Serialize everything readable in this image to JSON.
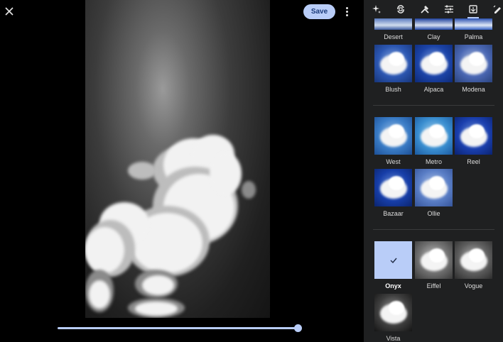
{
  "header": {
    "save_label": "Save"
  },
  "icons": {
    "close": "close-icon",
    "more": "more-vertical-icon"
  },
  "toolbar": {
    "tools": [
      "auto-enhance-icon",
      "crop-rotate-icon",
      "tools-icon",
      "adjust-icon",
      "filters-icon",
      "markup-icon"
    ],
    "active": "filters-icon"
  },
  "filters": {
    "row0": [
      "Desert",
      "Clay",
      "Palma"
    ],
    "row1": [
      "Blush",
      "Alpaca",
      "Modena"
    ],
    "row2": [
      "West",
      "Metro",
      "Reel"
    ],
    "row3": [
      "Bazaar",
      "Ollie"
    ],
    "row4": [
      "Onyx",
      "Eiffel",
      "Vogue"
    ],
    "row5": [
      "Vista"
    ],
    "selected": "Onyx"
  },
  "slider": {
    "value": 1.0
  },
  "colors": {
    "accent": "#b9cdf8",
    "panel_bg": "#1f2021"
  }
}
